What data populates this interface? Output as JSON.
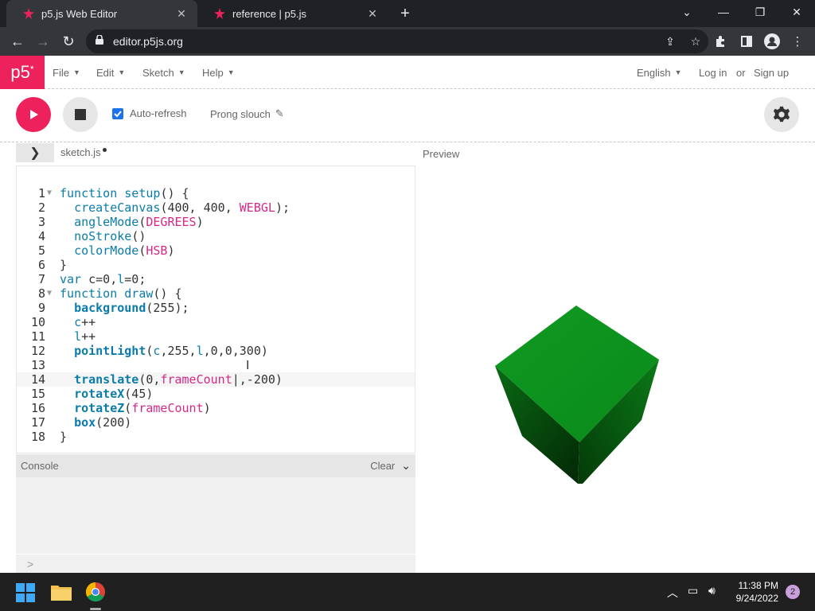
{
  "browser": {
    "tabs": [
      {
        "title": "p5.js Web Editor",
        "active": true
      },
      {
        "title": "reference | p5.js",
        "active": false
      }
    ],
    "url": "editor.p5js.org"
  },
  "p5": {
    "logo": "p5",
    "logo_sup": "*",
    "menus": [
      "File",
      "Edit",
      "Sketch",
      "Help"
    ],
    "language": "English",
    "login": "Log in",
    "or": "or",
    "signup": "Sign up",
    "auto_refresh": "Auto-refresh",
    "sketch_name": "Prong slouch",
    "file_name": "sketch.js",
    "preview_label": "Preview",
    "console_label": "Console",
    "clear_label": "Clear",
    "console_prompt": ">"
  },
  "code": {
    "line_numbers": [
      "1",
      "2",
      "3",
      "4",
      "5",
      "6",
      "7",
      "8",
      "9",
      "10",
      "11",
      "12",
      "13",
      "14",
      "15",
      "16",
      "17",
      "18"
    ],
    "active_line": 14
  },
  "taskbar": {
    "time": "11:38 PM",
    "date": "9/24/2022",
    "notifications": "2"
  },
  "colors": {
    "brand": "#ed225d",
    "cube": "#0a8a1a"
  }
}
